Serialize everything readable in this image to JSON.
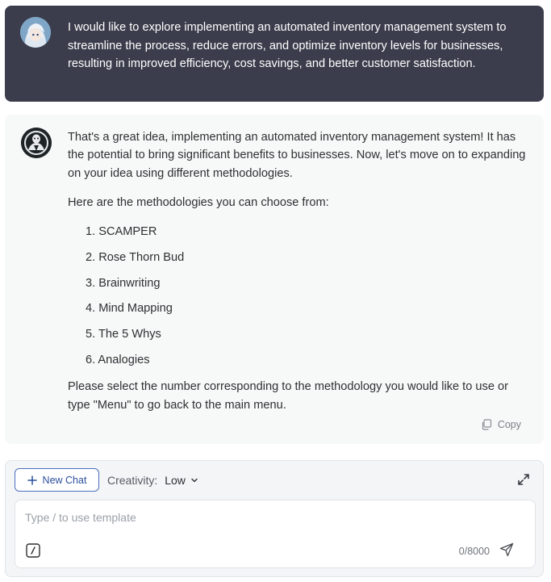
{
  "user_message": {
    "avatar_icon": "anime-character-avatar",
    "text": "I would like to explore implementing an automated inventory management system to streamline the process, reduce errors, and optimize inventory levels for businesses, resulting in improved efficiency, cost savings, and better customer satisfaction."
  },
  "bot_message": {
    "avatar_icon": "bot-avatar",
    "intro": "That's a great idea, implementing an automated inventory management system! It has the potential to bring significant benefits to businesses. Now, let's move on to expanding on your idea using different methodologies.",
    "intro2": "Here are the methodologies you can choose from:",
    "methods": [
      "1. SCAMPER",
      "2. Rose Thorn Bud",
      "3. Brainwriting",
      "4. Mind Mapping",
      "5. The 5 Whys",
      "6. Analogies"
    ],
    "outro": "Please select the number corresponding to the methodology you would like to use or type \"Menu\" to go back to the main menu.",
    "copy_label": "Copy"
  },
  "input_panel": {
    "new_chat_label": "New Chat",
    "creativity_label": "Creativity:",
    "creativity_value": "Low",
    "placeholder": "Type / to use template",
    "char_count": "0/8000"
  },
  "colors": {
    "user_bubble": "#3b3d4c",
    "bot_bubble": "#f7f8f8",
    "accent": "#2b4e9e"
  }
}
